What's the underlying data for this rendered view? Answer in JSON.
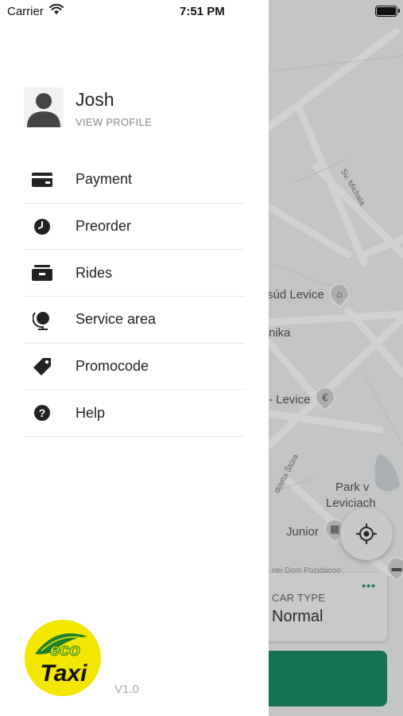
{
  "status_bar": {
    "carrier": "Carrier",
    "time": "7:51 PM"
  },
  "profile": {
    "name": "Josh",
    "view_profile": "VIEW PROFILE"
  },
  "menu": {
    "items": [
      {
        "label": "Payment",
        "icon": "credit-card-icon"
      },
      {
        "label": "Preorder",
        "icon": "clock-icon"
      },
      {
        "label": "Rides",
        "icon": "rides-icon"
      },
      {
        "label": "Service area",
        "icon": "globe-icon"
      },
      {
        "label": "Promocode",
        "icon": "tag-icon"
      },
      {
        "label": "Help",
        "icon": "help-icon"
      }
    ]
  },
  "footer": {
    "logo_text_top": "eco",
    "logo_text_bottom": "Taxi",
    "version": "V1.0"
  },
  "map": {
    "labels": {
      "street_1": "Sv. Michala",
      "place_1": "súd Levice",
      "street_2": "nika",
      "place_2": "- Levice",
      "street_3": "dovita Štúra",
      "park_line1": "Park v",
      "park_line2": "Leviciach",
      "place_3": "Junior",
      "street_4": "nej Dom Pozidacoo"
    },
    "car_type": {
      "label": "CAR TYPE",
      "value": "Normal"
    }
  },
  "colors": {
    "accent_green": "#1a8c65",
    "logo_yellow": "#f3e600"
  }
}
